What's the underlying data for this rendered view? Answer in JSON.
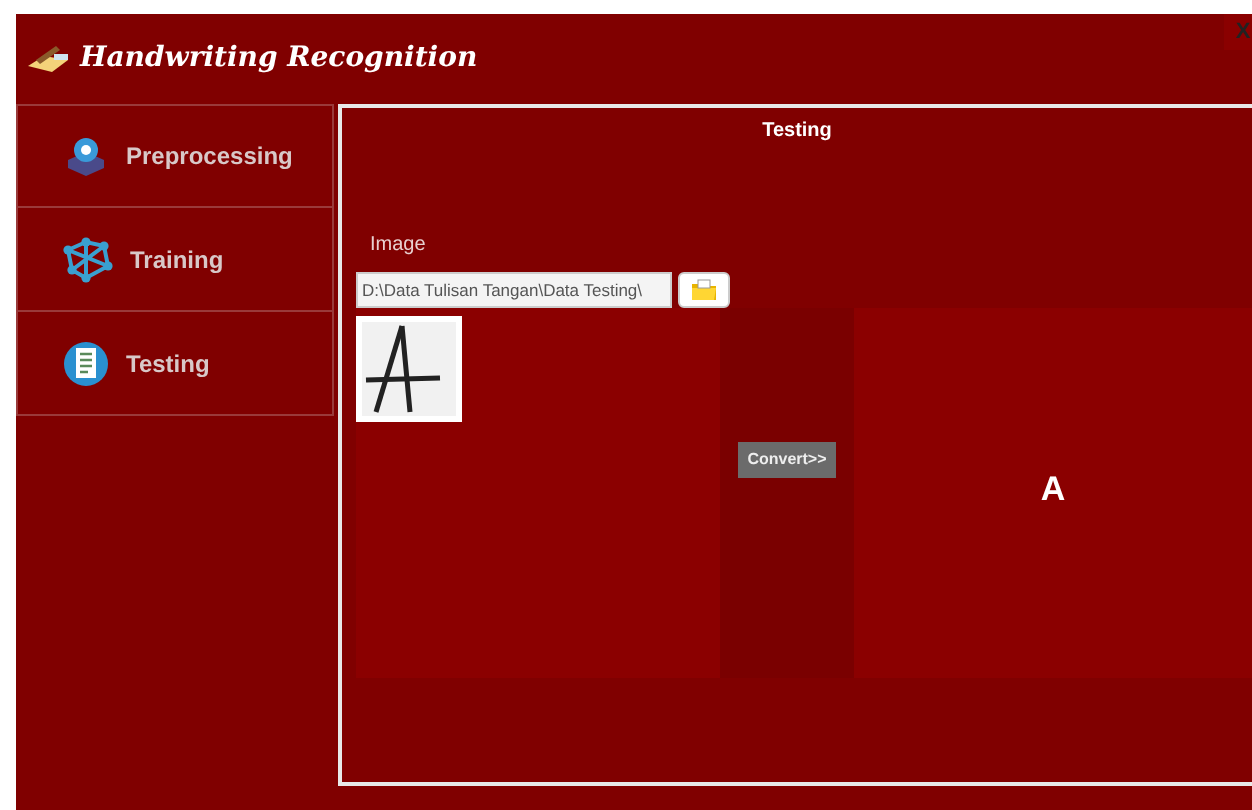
{
  "window": {
    "title": "Handwriting Recognition",
    "close": "X"
  },
  "sidebar": {
    "items": [
      {
        "label": "Preprocessing",
        "kind": "gear"
      },
      {
        "label": "Training",
        "kind": "network"
      },
      {
        "label": "Testing",
        "kind": "clipboard"
      }
    ]
  },
  "panel": {
    "title": "Testing",
    "image_label": "Image",
    "path_field": {
      "value": "D:\\Data Tulisan Tangan\\Data Testing\\"
    },
    "convert_button": "Convert>>",
    "result": "A"
  }
}
